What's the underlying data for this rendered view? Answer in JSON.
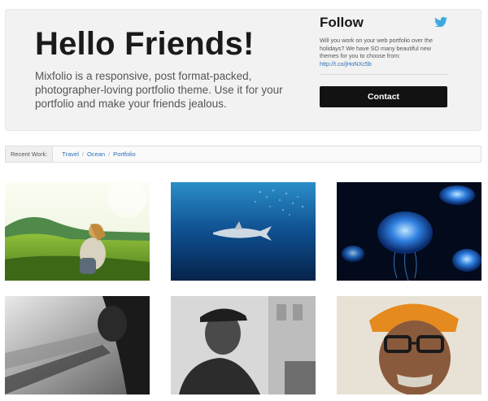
{
  "hero": {
    "title": "Hello Friends!",
    "description": "Mixfolio is a responsive, post format-packed, photographer-loving portfolio theme. Use it for your portfolio and make your friends jealous."
  },
  "follow": {
    "title": "Follow",
    "icon": "twitter-bird-icon",
    "tweet_text": "Will you work on your web portfolio over the holidays? We have SO many beautiful new themes for you to choose from:",
    "tweet_link": "http://t.co/jHoNXc5b"
  },
  "contact": {
    "label": "Contact"
  },
  "recent_work": {
    "label": "Recent Work:",
    "categories": [
      "Travel",
      "Ocean",
      "Portfolio"
    ]
  },
  "colors": {
    "accent": "#2a6fb8",
    "button": "#121212",
    "hero_bg": "#f2f2f2",
    "twitter": "#3fa9e0"
  },
  "gallery": [
    {
      "subject": "woman sitting on grassy hillside"
    },
    {
      "subject": "shark swimming underwater with fish school"
    },
    {
      "subject": "glowing blue jellyfish"
    },
    {
      "subject": "black-and-white person looking from train window"
    },
    {
      "subject": "black-and-white portrait of man in flat cap"
    },
    {
      "subject": "elderly man with orange turban and glasses"
    }
  ]
}
